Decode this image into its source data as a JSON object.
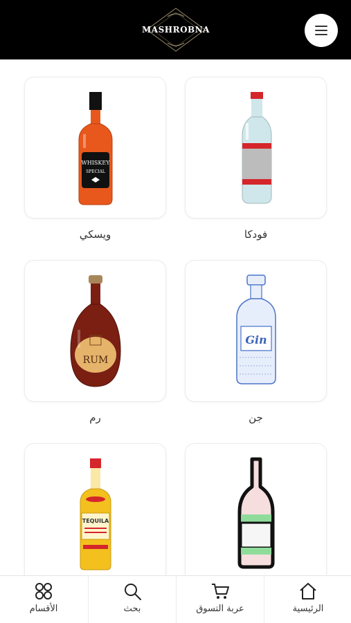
{
  "header": {
    "logo_text": "MASHROBNA",
    "menu_icon": "hamburger-icon"
  },
  "categories": [
    {
      "label": "فودكا",
      "icon": "vodka-bottle"
    },
    {
      "label": "ويسكي",
      "icon": "whiskey-bottle",
      "bottle_text_1": "WHISKEY",
      "bottle_text_2": "SPECIAL"
    },
    {
      "label": "جن",
      "icon": "gin-bottle",
      "bottle_text": "Gin"
    },
    {
      "label": "رم",
      "icon": "rum-bottle",
      "bottle_text": "RUM"
    },
    {
      "label": "",
      "icon": "green-label-bottle"
    },
    {
      "label": "",
      "icon": "tequila-bottle",
      "bottle_text": "TEQUILA"
    }
  ],
  "bottom_nav": [
    {
      "label": "الأقسام",
      "icon": "grid-icon"
    },
    {
      "label": "بحث",
      "icon": "search-icon"
    },
    {
      "label": "عربة التسوق",
      "icon": "cart-icon"
    },
    {
      "label": "الرئيسية",
      "icon": "home-icon"
    }
  ],
  "colors": {
    "header_bg": "#000000",
    "accent_red": "#d4262b",
    "whiskey_amber": "#e8581c",
    "rum_brown": "#7a1f12",
    "gin_blue": "#4a74c9",
    "tequila_yellow": "#f3c01e"
  }
}
